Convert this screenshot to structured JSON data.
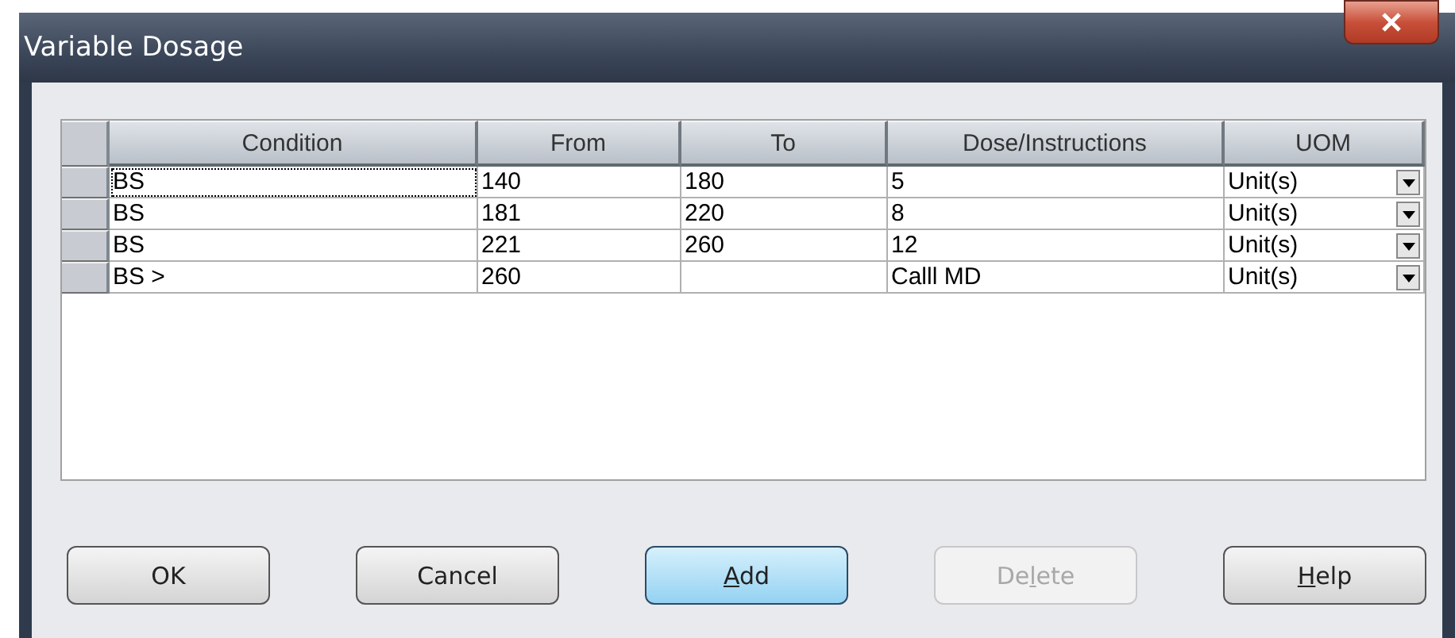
{
  "window": {
    "title": "Variable Dosage"
  },
  "table": {
    "columns": [
      "Condition",
      "From",
      "To",
      "Dose/Instructions",
      "UOM"
    ],
    "rows": [
      {
        "cells": [
          "BS",
          "140",
          "180",
          "5",
          "Unit(s)"
        ],
        "focused": true
      },
      {
        "cells": [
          "BS",
          "181",
          "220",
          "8",
          "Unit(s)"
        ],
        "focused": false
      },
      {
        "cells": [
          "BS",
          "221",
          "260",
          "12",
          "Unit(s)"
        ],
        "focused": false
      },
      {
        "cells": [
          "BS >",
          "260",
          null,
          "Calll MD",
          "Unit(s)"
        ],
        "focused": false
      }
    ]
  },
  "buttons": [
    {
      "before": "OK",
      "default": false,
      "disabled": false
    },
    {
      "before": "Cancel",
      "default": false,
      "disabled": false
    },
    {
      "key": "A",
      "after": "dd",
      "default": true,
      "disabled": false
    },
    {
      "before": "De",
      "key": "l",
      "after": "ete",
      "default": false,
      "disabled": true
    },
    {
      "key": "H",
      "after": "elp",
      "default": false,
      "disabled": false
    }
  ]
}
